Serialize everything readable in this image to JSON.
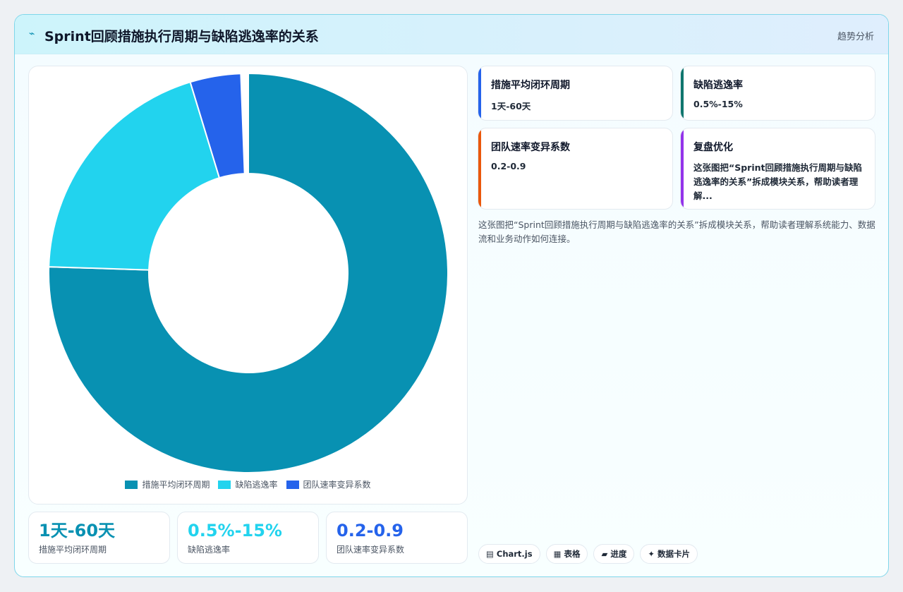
{
  "header": {
    "icon": "⌁",
    "title": "Sprint回顾措施执行周期与缺陷逃逸率的关系",
    "link": "趋势分析"
  },
  "chart_data": {
    "type": "pie",
    "donut": true,
    "categories": [
      "措施平均闭环周期",
      "缺陷逃逸率",
      "团队速率变异系数"
    ],
    "values": [
      75.5,
      19.8,
      4.1
    ],
    "colors": [
      "#0891b2",
      "#22d3ee",
      "#2563eb"
    ],
    "legend": "bottom"
  },
  "stats": [
    {
      "value": "1天-60天",
      "label": "措施平均闭环周期",
      "color": "#0891b2"
    },
    {
      "value": "0.5%-15%",
      "label": "缺陷逃逸率",
      "color": "#22d3ee"
    },
    {
      "value": "0.2-0.9",
      "label": "团队速率变异系数",
      "color": "#2563eb"
    }
  ],
  "cards": [
    {
      "title": "措施平均闭环周期",
      "value": "1天-60天",
      "accent": "#2563eb"
    },
    {
      "title": "缺陷逃逸率",
      "value": "0.5%-15%",
      "accent": "#0f766e"
    },
    {
      "title": "团队速率变异系数",
      "value": "0.2-0.9",
      "accent": "#ea580c"
    },
    {
      "title": "复盘优化",
      "text": "这张图把“Sprint回顾措施执行周期与缺陷逃逸率的关系”拆成模块关系，帮助读者理解...",
      "accent": "#9333ea"
    }
  ],
  "description": "这张图把“Sprint回顾措施执行周期与缺陷逃逸率的关系”拆成模块关系，帮助读者理解系统能力、数据流和业务动作如何连接。",
  "tags": [
    {
      "icon": "▤",
      "label": "Chart.js"
    },
    {
      "icon": "▦",
      "label": "表格"
    },
    {
      "icon": "▰",
      "label": "进度"
    },
    {
      "icon": "✦",
      "label": "数据卡片"
    }
  ]
}
